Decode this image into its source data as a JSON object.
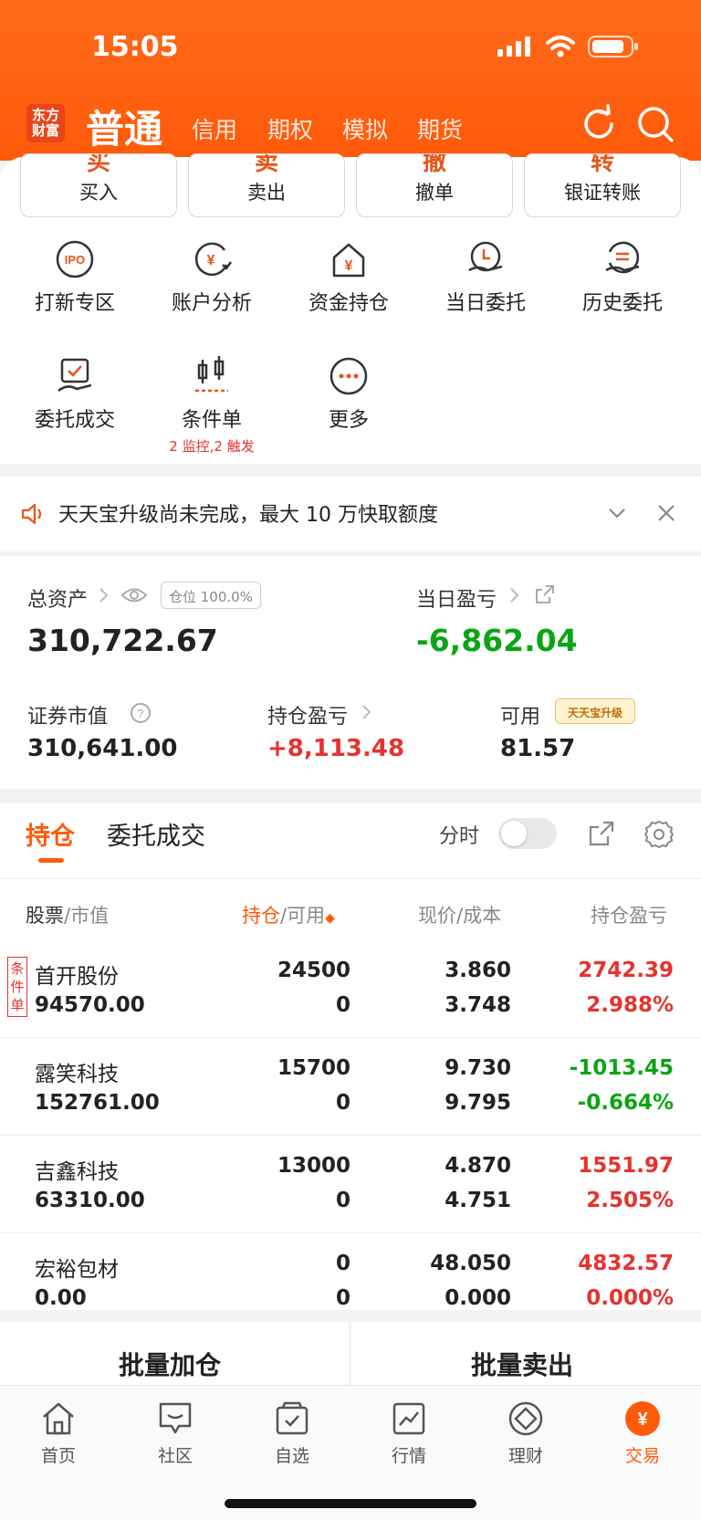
{
  "status": {
    "time": "15:05"
  },
  "header": {
    "logo_text": "东方财富",
    "tabs": [
      "普通",
      "信用",
      "期权",
      "模拟",
      "期货"
    ]
  },
  "quick_actions": [
    "买入",
    "卖出",
    "撤单",
    "银证转账"
  ],
  "grid": [
    {
      "label": "打新专区",
      "icon": "ipo-icon"
    },
    {
      "label": "账户分析",
      "icon": "account-analysis-icon"
    },
    {
      "label": "资金持仓",
      "icon": "funds-position-icon"
    },
    {
      "label": "当日委托",
      "icon": "today-orders-icon"
    },
    {
      "label": "历史委托",
      "icon": "history-orders-icon"
    },
    {
      "label": "委托成交",
      "icon": "order-deal-icon"
    },
    {
      "label": "条件单",
      "icon": "condition-order-icon",
      "sub": "2 监控,2 触发"
    },
    {
      "label": "更多",
      "icon": "more-icon"
    }
  ],
  "notice": {
    "text": "天天宝升级尚未完成，最大 10 万快取额度"
  },
  "assets": {
    "total_label": "总资产",
    "position_pill": "仓位 100.0%",
    "total_value": "310,722.67",
    "daily_label": "当日盈亏",
    "daily_value": "-6,862.04",
    "market_label": "证券市值",
    "market_value": "310,641.00",
    "hold_pl_label": "持仓盈亏",
    "hold_pl_value": "+8,113.48",
    "available_label": "可用",
    "available_badge": "天天宝升级",
    "available_value": "81.57"
  },
  "holdings": {
    "tab_active": "持仓",
    "tab_other": "委托成交",
    "toggle_label": "分时",
    "col_stock": "股票",
    "col_mv": "市值",
    "col_hold": "持仓",
    "col_avail": "可用",
    "col_price": "现价",
    "col_cost": "成本",
    "col_pl": "持仓盈亏",
    "condition_tag": "条件单",
    "rows": [
      {
        "name": "首开股份",
        "mv": "94570.00",
        "hold": "24500",
        "avail": "0",
        "price": "3.860",
        "cost": "3.748",
        "pl": "2742.39",
        "pct": "2.988%",
        "dir": "up",
        "tag": true
      },
      {
        "name": "露笑科技",
        "mv": "152761.00",
        "hold": "15700",
        "avail": "0",
        "price": "9.730",
        "cost": "9.795",
        "pl": "-1013.45",
        "pct": "-0.664%",
        "dir": "down",
        "tag": false
      },
      {
        "name": "吉鑫科技",
        "mv": "63310.00",
        "hold": "13000",
        "avail": "0",
        "price": "4.870",
        "cost": "4.751",
        "pl": "1551.97",
        "pct": "2.505%",
        "dir": "up",
        "tag": false
      },
      {
        "name": "宏裕包材",
        "mv": "0.00",
        "hold": "0",
        "avail": "0",
        "price": "48.050",
        "cost": "0.000",
        "pl": "4832.57",
        "pct": "0.000%",
        "dir": "up",
        "tag": false
      }
    ]
  },
  "batch": {
    "add": "批量加仓",
    "sell": "批量卖出"
  },
  "bottom_nav": [
    {
      "label": "首页",
      "icon": "home-icon"
    },
    {
      "label": "社区",
      "icon": "community-icon"
    },
    {
      "label": "自选",
      "icon": "watchlist-icon"
    },
    {
      "label": "行情",
      "icon": "market-icon"
    },
    {
      "label": "理财",
      "icon": "wealth-icon"
    },
    {
      "label": "交易",
      "icon": "trade-icon",
      "active": true
    }
  ],
  "colors": {
    "accent": "#ff5a0a",
    "up": "#e6322e",
    "down": "#0aa514"
  }
}
